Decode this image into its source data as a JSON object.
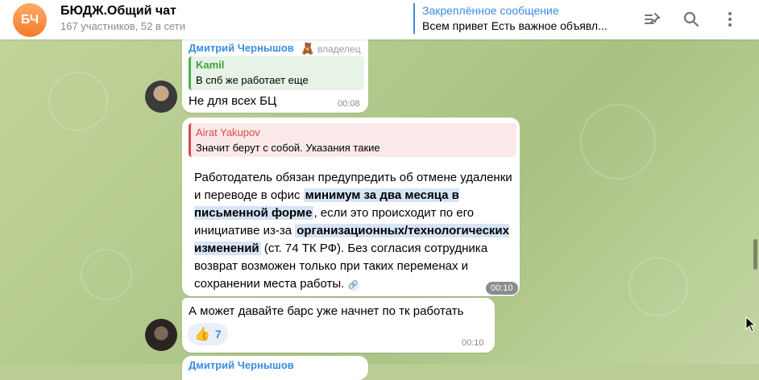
{
  "header": {
    "avatar_initials": "БЧ",
    "title": "БЮДЖ.Общий чат",
    "subtitle": "167 участников, 52 в сети",
    "pinned_label": "Закреплённое сообщение",
    "pinned_text": "Всем привет Есть важное объявл...",
    "icons": [
      "pin-list-icon",
      "search-icon",
      "more-vert-icon"
    ]
  },
  "messages": [
    {
      "sender": "Дмитрий Чернышов",
      "role": "владелец",
      "reply_name": "Kamil",
      "reply_text": "В спб же работает еще",
      "text": "Не для всех БЦ",
      "time": "00:08"
    },
    {
      "reply_name": "Airat Yakupov",
      "reply_text": "Значит берут с собой. Указания такие",
      "body_part1": "Работодатель обязан предупредить об отмене удаленки и переводе в офис ",
      "body_hl1": "минимум за два месяца в письменной форме",
      "body_part2": ", если это происходит по его инициативе из-за ",
      "body_hl2": "организационных/технологических изменений",
      "body_part3": " (ст. 74 ТК РФ). Без согласия сотрудника возврат возможен только при таких переменах и сохранении места работы.",
      "time": "00:10"
    },
    {
      "text": "А может давайте барс уже начнет по тк работать",
      "reaction_emoji": "👍",
      "reaction_count": "7",
      "time": "00:10"
    },
    {
      "sender": "Дмитрий Чернышов"
    }
  ],
  "colors": {
    "accent": "#3a8de0",
    "reply_red": "#d94a4a",
    "highlight": "#d6e4f6"
  }
}
